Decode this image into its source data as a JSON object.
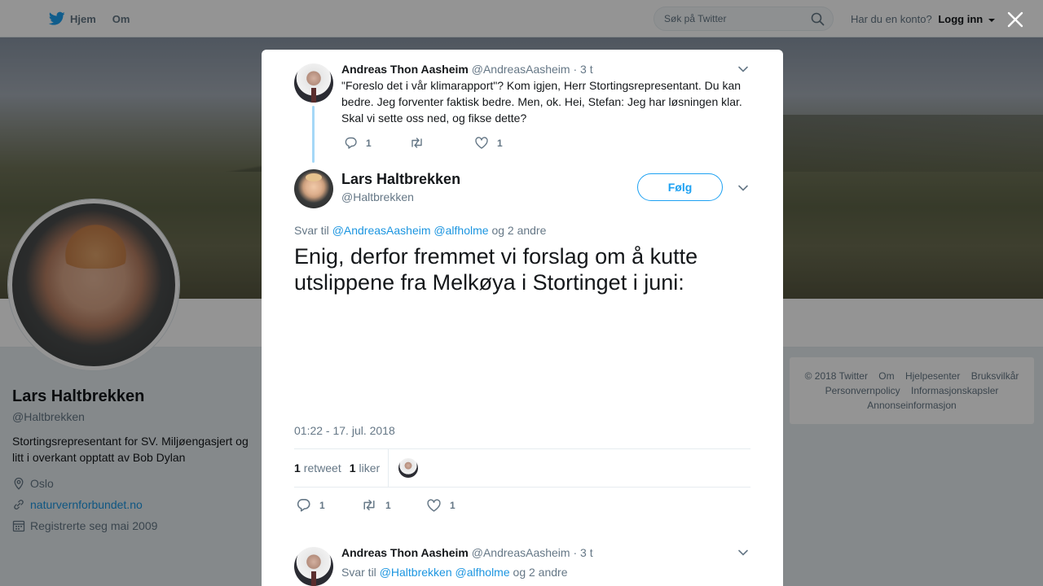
{
  "topbar": {
    "nav": [
      {
        "label": "Hjem",
        "icon": "twitter-bird-icon"
      },
      {
        "label": "Om"
      }
    ],
    "search_placeholder": "Søk på Twitter",
    "account_prompt": "Har du en konto?",
    "login_label": "Logg inn"
  },
  "profile": {
    "name": "Lars Haltbrekken",
    "handle": "@Haltbrekken",
    "bio": "Stortingsrepresentant for SV. Miljøengasjert og litt i overkant opptatt av Bob Dylan",
    "location": "Oslo",
    "website": "naturvernforbundet.no",
    "joined": "Registrerte seg mai 2009"
  },
  "footer": {
    "links": [
      "© 2018 Twitter",
      "Om",
      "Hjelpesenter",
      "Bruksvilkår",
      "Personvernpolicy",
      "Informasjonskapsler",
      "Annonseinformasjon"
    ]
  },
  "modal": {
    "parent_tweet": {
      "name": "Andreas Thon Aasheim",
      "handle": "@AndreasAasheim",
      "time": "· 3 t",
      "text": "\"Foreslo det i vår klimarapport\"? Kom igjen, Herr Stortingsrepresentant. Du kan bedre. Jeg forventer faktisk bedre. Men, ok. Hei, Stefan: Jeg har løsningen klar. Skal vi sette oss ned, og fikse dette?",
      "replies": "1",
      "likes": "1"
    },
    "main_tweet": {
      "name": "Lars Haltbrekken",
      "handle": "@Haltbrekken",
      "follow_label": "Følg",
      "reply_prefix": "Svar til",
      "mention_1": "@AndreasAasheim",
      "mention_2": "@alfholme",
      "reply_suffix": "og 2 andre",
      "text": "Enig, derfor fremmet vi forslag om å kutte utslippene fra Melkøya i Stortinget i juni:",
      "timestamp": "01:22 - 17. jul. 2018",
      "retweet_count": "1",
      "retweet_label": "retweet",
      "like_count": "1",
      "like_label": "liker",
      "replies": "1",
      "retweets": "1",
      "likes": "1"
    },
    "reply_tweet": {
      "name": "Andreas Thon Aasheim",
      "handle": "@AndreasAasheim",
      "time": "· 3 t",
      "reply_prefix": "Svar til",
      "mention_1": "@Haltbrekken",
      "mention_2": "@alfholme",
      "reply_suffix": "og 2 andre"
    }
  },
  "colors": {
    "accent": "#1da1f2",
    "link": "#1b95e0",
    "muted": "#657786",
    "text": "#14171a",
    "thread_line": "#a5d8f7"
  }
}
